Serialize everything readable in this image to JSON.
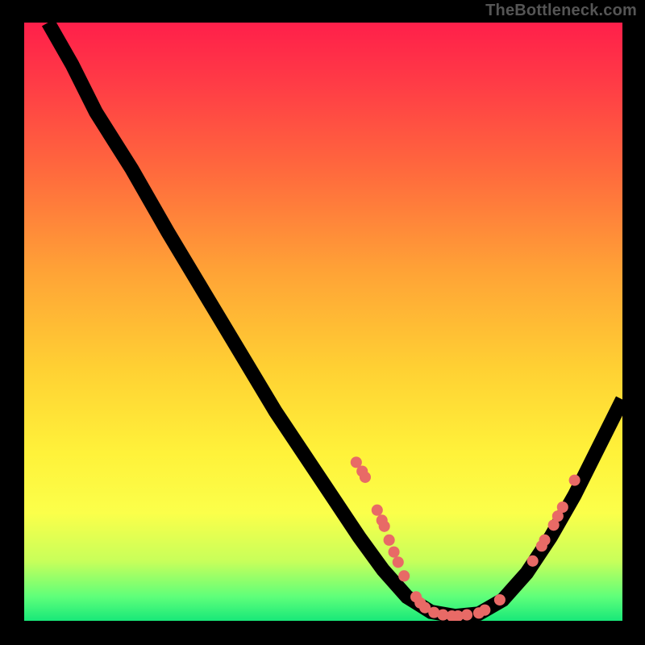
{
  "watermark": "TheBottleneck.com",
  "chart_data": {
    "type": "line",
    "title": "",
    "xlabel": "",
    "ylabel": "",
    "xlim": [
      0,
      100
    ],
    "ylim": [
      0,
      100
    ],
    "curve": [
      {
        "x": 4.0,
        "y": 100.0
      },
      {
        "x": 8.0,
        "y": 93.0
      },
      {
        "x": 12.0,
        "y": 85.0
      },
      {
        "x": 18.0,
        "y": 75.5
      },
      {
        "x": 24.0,
        "y": 65.0
      },
      {
        "x": 30.0,
        "y": 55.0
      },
      {
        "x": 36.0,
        "y": 45.0
      },
      {
        "x": 42.0,
        "y": 35.0
      },
      {
        "x": 48.0,
        "y": 26.0
      },
      {
        "x": 52.0,
        "y": 20.0
      },
      {
        "x": 56.0,
        "y": 14.0
      },
      {
        "x": 60.0,
        "y": 8.5
      },
      {
        "x": 64.0,
        "y": 4.0
      },
      {
        "x": 68.0,
        "y": 1.5
      },
      {
        "x": 72.0,
        "y": 0.8
      },
      {
        "x": 76.0,
        "y": 1.2
      },
      {
        "x": 80.0,
        "y": 3.5
      },
      {
        "x": 84.0,
        "y": 8.0
      },
      {
        "x": 88.0,
        "y": 14.0
      },
      {
        "x": 92.0,
        "y": 21.0
      },
      {
        "x": 96.0,
        "y": 29.0
      },
      {
        "x": 100.0,
        "y": 37.0
      }
    ],
    "points": [
      {
        "x": 55.5,
        "y": 26.5
      },
      {
        "x": 56.5,
        "y": 25.0
      },
      {
        "x": 57.0,
        "y": 24.0
      },
      {
        "x": 59.0,
        "y": 18.5
      },
      {
        "x": 59.8,
        "y": 16.8
      },
      {
        "x": 60.2,
        "y": 15.8
      },
      {
        "x": 61.0,
        "y": 13.5
      },
      {
        "x": 61.8,
        "y": 11.5
      },
      {
        "x": 62.5,
        "y": 9.8
      },
      {
        "x": 63.5,
        "y": 7.5
      },
      {
        "x": 65.5,
        "y": 4.0
      },
      {
        "x": 66.2,
        "y": 3.0
      },
      {
        "x": 67.0,
        "y": 2.2
      },
      {
        "x": 68.5,
        "y": 1.4
      },
      {
        "x": 70.0,
        "y": 1.0
      },
      {
        "x": 71.5,
        "y": 0.8
      },
      {
        "x": 72.5,
        "y": 0.8
      },
      {
        "x": 74.0,
        "y": 1.0
      },
      {
        "x": 76.0,
        "y": 1.3
      },
      {
        "x": 77.0,
        "y": 1.8
      },
      {
        "x": 79.5,
        "y": 3.5
      },
      {
        "x": 85.0,
        "y": 10.0
      },
      {
        "x": 86.5,
        "y": 12.5
      },
      {
        "x": 87.0,
        "y": 13.5
      },
      {
        "x": 88.5,
        "y": 16.0
      },
      {
        "x": 89.2,
        "y": 17.5
      },
      {
        "x": 90.0,
        "y": 19.0
      },
      {
        "x": 92.0,
        "y": 23.5
      }
    ],
    "point_color": "#e86a66",
    "curve_color": "#000000",
    "background_gradient": [
      "#ff1f4a",
      "#ff3b46",
      "#ff6a3d",
      "#ffa436",
      "#ffd133",
      "#fff23a",
      "#fbff4a",
      "#c8ff5a",
      "#5eff7a",
      "#18e879"
    ]
  }
}
